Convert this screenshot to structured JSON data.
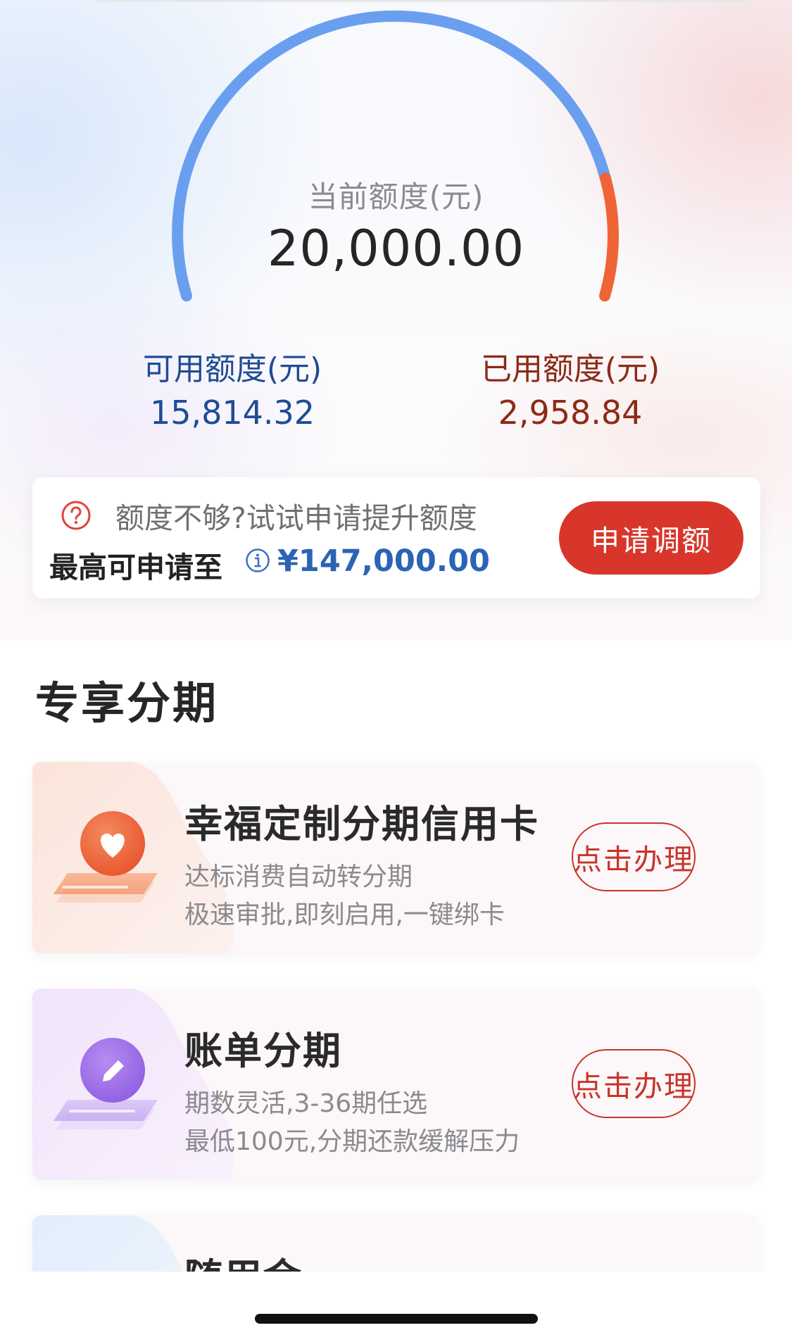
{
  "gauge": {
    "title": "当前额度(元)",
    "value": "20,000.00",
    "used_fraction": 0.148,
    "available_color": "#6a9ff0",
    "used_color": "#ef6436"
  },
  "available": {
    "label": "可用额度(元)",
    "value": "15,814.32"
  },
  "used": {
    "label": "已用额度(元)",
    "value": "2,958.84"
  },
  "limit_card": {
    "hint": "额度不够?试试申请提升额度",
    "max_label": "最高可申请至",
    "max_amount": "¥147,000.00",
    "button_label": "申请调额",
    "button_color": "#d9362b"
  },
  "section": {
    "title": "专享分期"
  },
  "promos": [
    {
      "title": "幸福定制分期信用卡",
      "line1": "达标消费自动转分期",
      "line2": "极速审批,即刻启用,一键绑卡",
      "button": "点击办理",
      "icon": "heart-icon"
    },
    {
      "title": "账单分期",
      "line1": "期数灵活,3-36期任选",
      "line2": "最低100元,分期还款缓解压力",
      "button": "点击办理",
      "icon": "pencil-icon"
    },
    {
      "title": "随用金",
      "icon": "circle-icon"
    }
  ]
}
